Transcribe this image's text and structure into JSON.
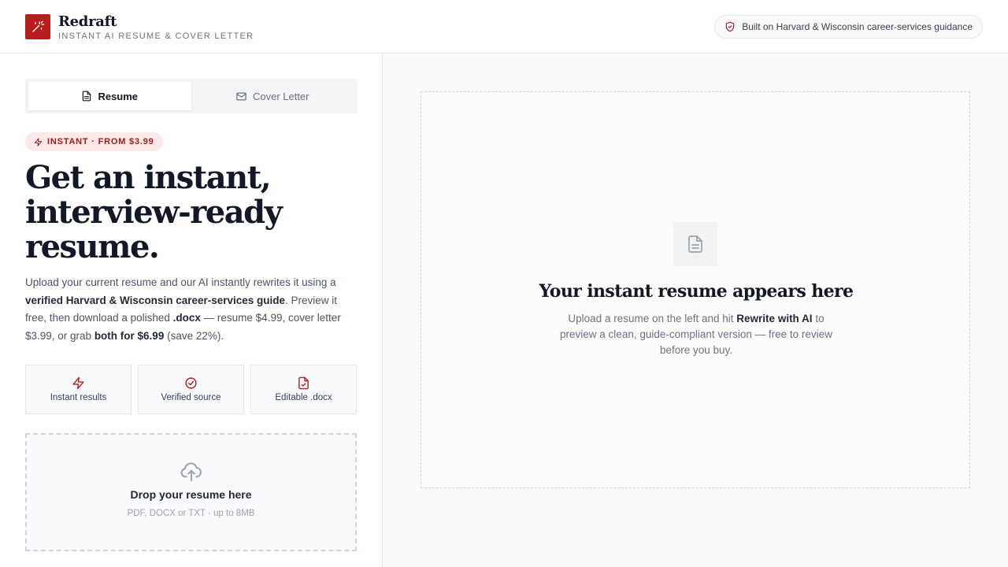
{
  "brand": {
    "name": "Redraft",
    "tagline": "INSTANT AI RESUME & COVER LETTER",
    "logo_color": "#b91c1c"
  },
  "header": {
    "trust_pill": "Built on Harvard & Wisconsin career-services guidance",
    "trust_icon": "shield-check-icon"
  },
  "tabs": [
    {
      "label": "Resume",
      "icon": "document-icon",
      "active": true
    },
    {
      "label": "Cover Letter",
      "icon": "mail-icon",
      "active": false
    }
  ],
  "hero": {
    "badge": "INSTANT · FROM $3.99",
    "headline_lines": [
      "Get an instant,",
      "interview-ready",
      "resume."
    ],
    "intro": {
      "t1": "Upload your current resume and our AI instantly rewrites it using a ",
      "b1": "verified Harvard & Wisconsin career-services guide",
      "t2": ". Preview it free, then download a polished ",
      "b2": ".docx",
      "t3": " — resume $4.99, cover letter $3.99, or grab ",
      "b3": "both for $6.99",
      "t4": " (save 22%)."
    }
  },
  "features": [
    {
      "label": "Instant results",
      "icon": "lightning-icon"
    },
    {
      "label": "Verified source",
      "icon": "check-circle-icon"
    },
    {
      "label": "Editable .docx",
      "icon": "file-check-icon"
    }
  ],
  "dropzone": {
    "title": "Drop your resume here",
    "subtitle": "PDF, DOCX or TXT · up to 8MB",
    "icon": "cloud-upload-icon"
  },
  "preview": {
    "title": "Your instant resume appears here",
    "desc_t1": "Upload a resume on the left and hit ",
    "desc_b1": "Rewrite with AI",
    "desc_t2": " to preview a clean, guide-compliant version — free to review before you buy.",
    "icon": "document-icon"
  },
  "colors": {
    "accent": "#b91c1c",
    "badge_bg": "#fde8e8",
    "border": "#e5e7eb"
  }
}
